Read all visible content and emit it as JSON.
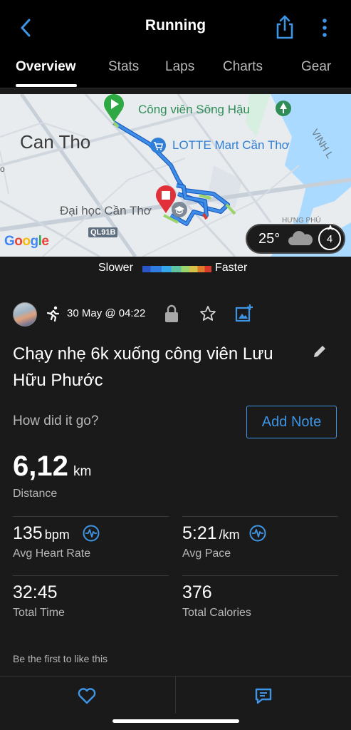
{
  "header": {
    "title": "Running",
    "back_icon": "chevron-left-icon",
    "share_icon": "share-icon",
    "more_icon": "more-vertical-icon",
    "accent": "#3f95e5"
  },
  "tabs": [
    {
      "label": "Overview",
      "active": true
    },
    {
      "label": "Stats",
      "active": false
    },
    {
      "label": "Laps",
      "active": false
    },
    {
      "label": "Charts",
      "active": false
    },
    {
      "label": "Gear",
      "active": false
    }
  ],
  "map": {
    "city_label": "Can Tho",
    "park_label": "Công viên Sông Hậu",
    "mart_label": "LOTTE Mart Cần Thơ",
    "university_label": "Đại học Cần Thơ",
    "river_label": "VINH L",
    "area_label": "HƯNG PHÚ",
    "road_label": "QL91B",
    "left_edge_label": "o",
    "provider": "Google",
    "weather": {
      "temperature": "25°",
      "condition_icon": "cloud-icon",
      "wind": "4"
    }
  },
  "legend": {
    "slower": "Slower",
    "faster": "Faster"
  },
  "activity": {
    "activity_icon": "running-icon",
    "date": "30 May @ 04:22",
    "privacy_icon": "lock-icon",
    "title": "Chạy nhẹ 6k xuống công viên Lưu Hữu Phước",
    "prompt": "How did it go?",
    "add_note_label": "Add Note"
  },
  "distance": {
    "value": "6,12",
    "unit": "km",
    "label": "Distance"
  },
  "stats": [
    {
      "value": "135",
      "unit": "bpm",
      "label": "Avg Heart Rate",
      "icon": "heart-rate-icon"
    },
    {
      "value": "5:21",
      "unit": "/km",
      "label": "Avg Pace",
      "icon": "heart-rate-icon"
    },
    {
      "value": "32:45",
      "unit": "",
      "label": "Total Time"
    },
    {
      "value": "376",
      "unit": "",
      "label": "Total Calories"
    }
  ],
  "social": {
    "like_prompt": "Be the first to like this"
  },
  "bottom_bar": {
    "like_icon": "heart-icon",
    "comment_icon": "comment-icon"
  }
}
